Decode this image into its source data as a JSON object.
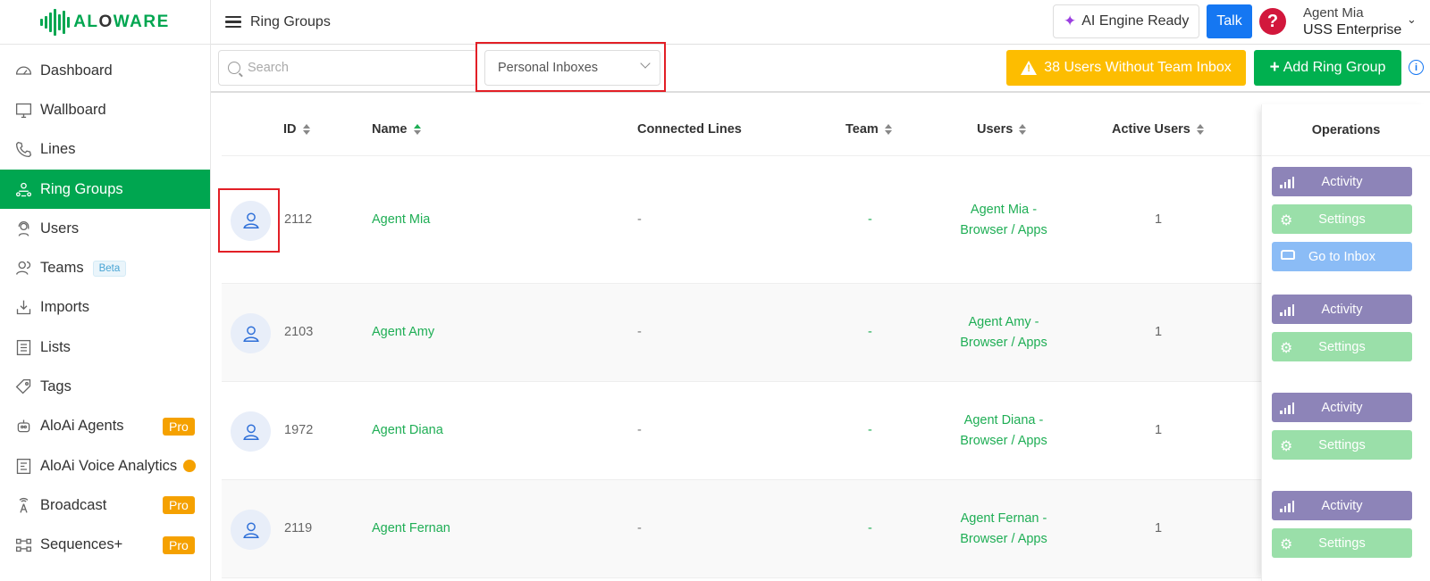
{
  "brand": {
    "logo_text_a": "AL",
    "logo_text_b": "O",
    "logo_text_c": "WARE"
  },
  "sidebar": {
    "items": [
      {
        "label": "Dashboard",
        "icon": "dashboard-icon"
      },
      {
        "label": "Wallboard",
        "icon": "monitor-icon"
      },
      {
        "label": "Lines",
        "icon": "phone-icon"
      },
      {
        "label": "Ring Groups",
        "icon": "ring-groups-icon",
        "active": true
      },
      {
        "label": "Users",
        "icon": "user-headset-icon"
      },
      {
        "label": "Teams",
        "icon": "teams-icon",
        "badge": "Beta"
      },
      {
        "label": "Imports",
        "icon": "import-icon"
      },
      {
        "label": "Lists",
        "icon": "list-icon"
      },
      {
        "label": "Tags",
        "icon": "tag-icon"
      },
      {
        "label": "AloAi Agents",
        "icon": "robot-icon",
        "badge": "Pro"
      },
      {
        "label": "AloAi Voice Analytics",
        "icon": "analytics-icon"
      },
      {
        "label": "Broadcast",
        "icon": "broadcast-icon",
        "badge": "Pro"
      },
      {
        "label": "Sequences+",
        "icon": "sequence-icon",
        "badge": "Pro"
      }
    ]
  },
  "header": {
    "title": "Ring Groups",
    "ai_engine": "AI Engine Ready",
    "talk": "Talk",
    "help": "?",
    "agent_name": "Agent Mia",
    "agent_company": "USS Enterprise"
  },
  "toolbar": {
    "search_placeholder": "Search",
    "filter_value": "Personal Inboxes",
    "warning_label": "38 Users Without Team Inbox",
    "add_label": "Add Ring Group"
  },
  "table": {
    "columns": {
      "id": "ID",
      "name": "Name",
      "lines": "Connected Lines",
      "team": "Team",
      "users": "Users",
      "active": "Active Users",
      "operations": "Operations"
    },
    "rows": [
      {
        "id": "2112",
        "name": "Agent Mia",
        "lines": "-",
        "team": "-",
        "users_1": "Agent Mia -",
        "users_2": "Browser / Apps",
        "active": "1",
        "buttons": [
          "Activity",
          "Settings",
          "Go to Inbox"
        ]
      },
      {
        "id": "2103",
        "name": "Agent Amy",
        "lines": "-",
        "team": "-",
        "users_1": "Agent Amy -",
        "users_2": "Browser / Apps",
        "active": "1",
        "buttons": [
          "Activity",
          "Settings"
        ]
      },
      {
        "id": "1972",
        "name": "Agent Diana",
        "lines": "-",
        "team": "-",
        "users_1": "Agent Diana -",
        "users_2": "Browser / Apps",
        "active": "1",
        "buttons": [
          "Activity",
          "Settings"
        ]
      },
      {
        "id": "2119",
        "name": "Agent Fernan",
        "lines": "-",
        "team": "-",
        "users_1": "Agent Fernan -",
        "users_2": "Browser / Apps",
        "active": "1",
        "buttons": [
          "Activity",
          "Settings"
        ]
      }
    ]
  },
  "colors": {
    "brand_green": "#00a650",
    "warning": "#fdbd00",
    "talk_blue": "#1577f2",
    "activity": "#8d84b8",
    "settings": "#9adfa9",
    "inbox": "#8bbcf6"
  }
}
